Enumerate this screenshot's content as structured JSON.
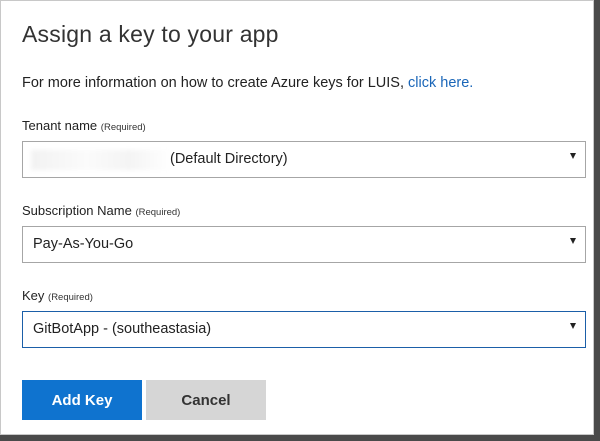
{
  "dialog": {
    "title": "Assign a key to your app",
    "info_text": "For more information on how to create Azure keys for LUIS, ",
    "info_link": "click here."
  },
  "fields": {
    "tenant": {
      "label": "Tenant name",
      "required": "(Required)",
      "value": "(Default Directory)"
    },
    "subscription": {
      "label": "Subscription Name",
      "required": "(Required)",
      "value": "Pay-As-You-Go"
    },
    "key": {
      "label": "Key",
      "required": "(Required)",
      "value": "GitBotApp - (southeastasia)"
    }
  },
  "buttons": {
    "add_key": "Add Key",
    "cancel": "Cancel"
  },
  "colors": {
    "primary_button": "#0f73cf",
    "secondary_button": "#d6d6d6",
    "link": "#1a66b8",
    "focus_border": "#1b5fa8"
  },
  "icons": {
    "dropdown": "caret-down-icon"
  }
}
